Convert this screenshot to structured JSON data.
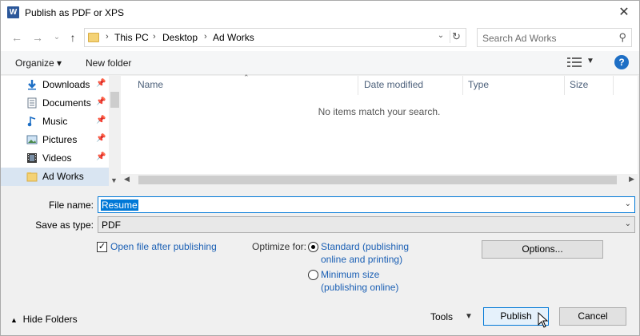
{
  "window": {
    "title": "Publish as PDF or XPS",
    "app_icon": "W"
  },
  "nav": {
    "breadcrumbs": [
      "This PC",
      "Desktop",
      "Ad Works"
    ],
    "search_placeholder": "Search Ad Works"
  },
  "toolbar": {
    "organize": "Organize ▾",
    "new_folder": "New folder",
    "help": "?"
  },
  "sidebar": {
    "items": [
      {
        "label": "Downloads",
        "icon": "download-icon",
        "pinned": true
      },
      {
        "label": "Documents",
        "icon": "documents-icon",
        "pinned": true
      },
      {
        "label": "Music",
        "icon": "music-icon",
        "pinned": true
      },
      {
        "label": "Pictures",
        "icon": "pictures-icon",
        "pinned": true
      },
      {
        "label": "Videos",
        "icon": "videos-icon",
        "pinned": true
      },
      {
        "label": "Ad Works",
        "icon": "folder-icon",
        "pinned": false,
        "selected": true
      }
    ]
  },
  "filelist": {
    "columns": [
      "Name",
      "Date modified",
      "Type",
      "Size"
    ],
    "empty_message": "No items match your search."
  },
  "form": {
    "file_name_label": "File name:",
    "file_name_value": "Resume",
    "save_type_label": "Save as type:",
    "save_type_value": "PDF",
    "open_after_label": "Open file after publishing",
    "open_after_checked": true,
    "optimize_label": "Optimize for:",
    "standard_label_1": "Standard (publishing",
    "standard_label_2": "online and printing)",
    "minimum_label_1": "Minimum size",
    "minimum_label_2": "(publishing online)",
    "optimize_selected": "standard",
    "options_button": "Options..."
  },
  "footer": {
    "hide_folders": "Hide Folders",
    "tools": "Tools",
    "publish": "Publish",
    "cancel": "Cancel"
  },
  "colors": {
    "accent": "#0078d7",
    "link": "#1a5fb4",
    "selected_nav": "#d9e5f2"
  }
}
